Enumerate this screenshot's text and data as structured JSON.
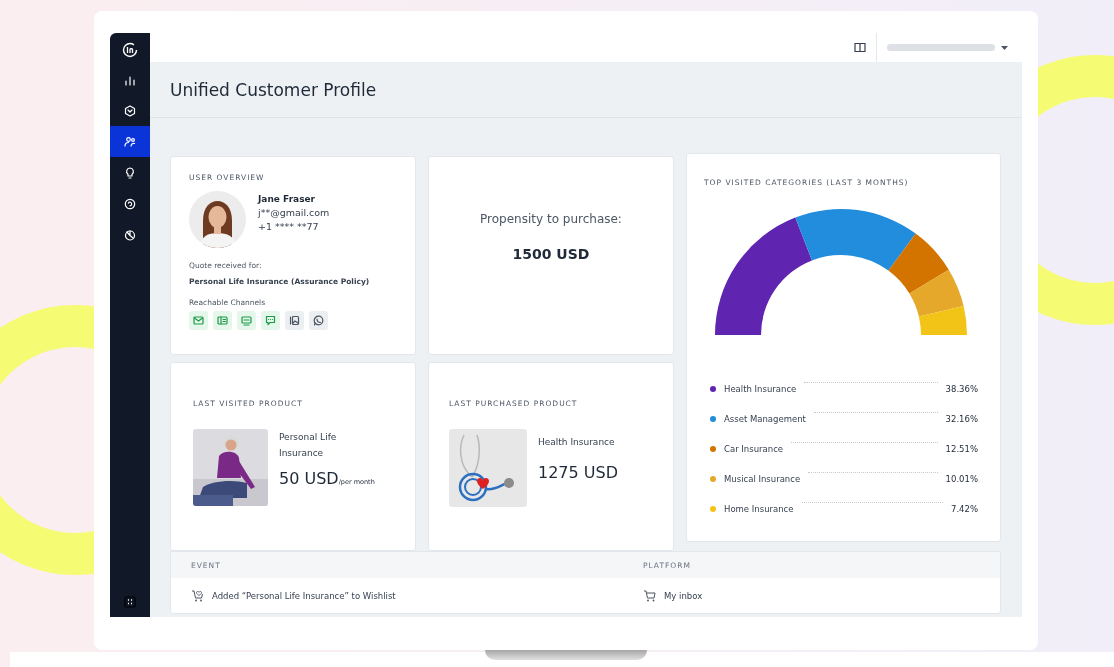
{
  "sidebar": {
    "items": [
      {
        "selected": false
      },
      {
        "selected": false
      },
      {
        "selected": true
      },
      {
        "selected": false
      },
      {
        "selected": false
      },
      {
        "selected": false
      }
    ]
  },
  "page": {
    "title": "Unified Customer Profile"
  },
  "user_overview": {
    "title": "USER OVERVIEW",
    "name": "Jane Fraser",
    "email": "j**@gmail.com",
    "phone": "+1 **** **77",
    "quote_label": "Quote received for:",
    "quote_product": "Personal Life Insurance (Assurance Policy)",
    "channels_label": "Reachable Channels",
    "channels": [
      {
        "kind": "email",
        "available": true
      },
      {
        "kind": "card",
        "available": true
      },
      {
        "kind": "sms",
        "available": true
      },
      {
        "kind": "chat",
        "available": true
      },
      {
        "kind": "gallery",
        "available": false
      },
      {
        "kind": "whatsapp",
        "available": false
      }
    ]
  },
  "propensity": {
    "label": "Propensity to purchase:",
    "value": "1500 USD"
  },
  "top_categories": {
    "title": "TOP VISITED CATEGORIES (LAST 3 MONTHS)",
    "chart_data": {
      "type": "donut",
      "categories": [
        "Health Insurance",
        "Asset Management",
        "Car Insurance",
        "Musical Insurance",
        "Home Insurance"
      ],
      "values": [
        38.36,
        32.16,
        12.51,
        10.01,
        7.42
      ],
      "value_labels": [
        "38.36%",
        "32.16%",
        "12.51%",
        "10.01%",
        "7.42%"
      ]
    },
    "legend": [
      {
        "color": "#5f24b0"
      },
      {
        "color": "#238ddd"
      },
      {
        "color": "#d47400"
      },
      {
        "color": "#e6a82b"
      },
      {
        "color": "#f2c417"
      }
    ]
  },
  "last_visited": {
    "title": "LAST VISITED PRODUCT",
    "name": "Personal Life Insurance",
    "price": "50 USD$_{/per month}$"
  },
  "last_purchased": {
    "title": "LAST PURCHASED PRODUCT",
    "name": "Health Insurance",
    "price": "1275 USD"
  },
  "events": {
    "columns": [
      "EVENT",
      "PLATFORM"
    ],
    "rows": [
      {
        "event": "Added “Personal Life Insurance” to Wishlist",
        "platform": "My inbox"
      }
    ]
  }
}
